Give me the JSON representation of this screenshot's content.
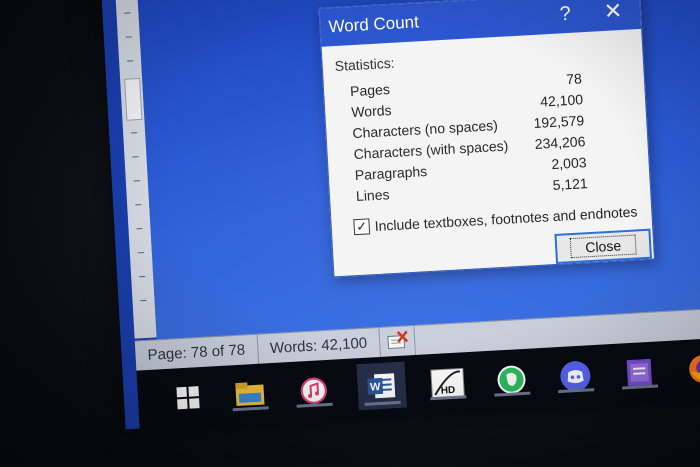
{
  "dialog": {
    "title": "Word Count",
    "help_label": "?",
    "close_x_label": "✕",
    "statistics_heading": "Statistics:",
    "stats": [
      {
        "label": "Pages",
        "value": "78"
      },
      {
        "label": "Words",
        "value": "42,100"
      },
      {
        "label": "Characters (no spaces)",
        "value": "192,579"
      },
      {
        "label": "Characters (with spaces)",
        "value": "234,206"
      },
      {
        "label": "Paragraphs",
        "value": "2,003"
      },
      {
        "label": "Lines",
        "value": "5,121"
      }
    ],
    "include_checkbox_label": "Include textboxes, footnotes and endnotes",
    "include_checked": true,
    "close_button_label": "Close"
  },
  "status_bar": {
    "page": "Page: 78 of 78",
    "words": "Words: 42,100"
  },
  "taskbar": {
    "items": [
      {
        "name": "windows-start-icon"
      },
      {
        "name": "file-explorer-icon"
      },
      {
        "name": "itunes-icon"
      },
      {
        "name": "microsoft-word-icon"
      },
      {
        "name": "hd-app-icon",
        "label": "HD"
      },
      {
        "name": "evernote-icon"
      },
      {
        "name": "discord-icon"
      },
      {
        "name": "onenote-icon"
      },
      {
        "name": "firefox-icon"
      }
    ]
  },
  "colors": {
    "title_bar": "#2c56cf",
    "desktop_blue": "#1d45c0",
    "dialog_bg": "#f4f4f4",
    "button_focus": "#2c6ed8"
  }
}
